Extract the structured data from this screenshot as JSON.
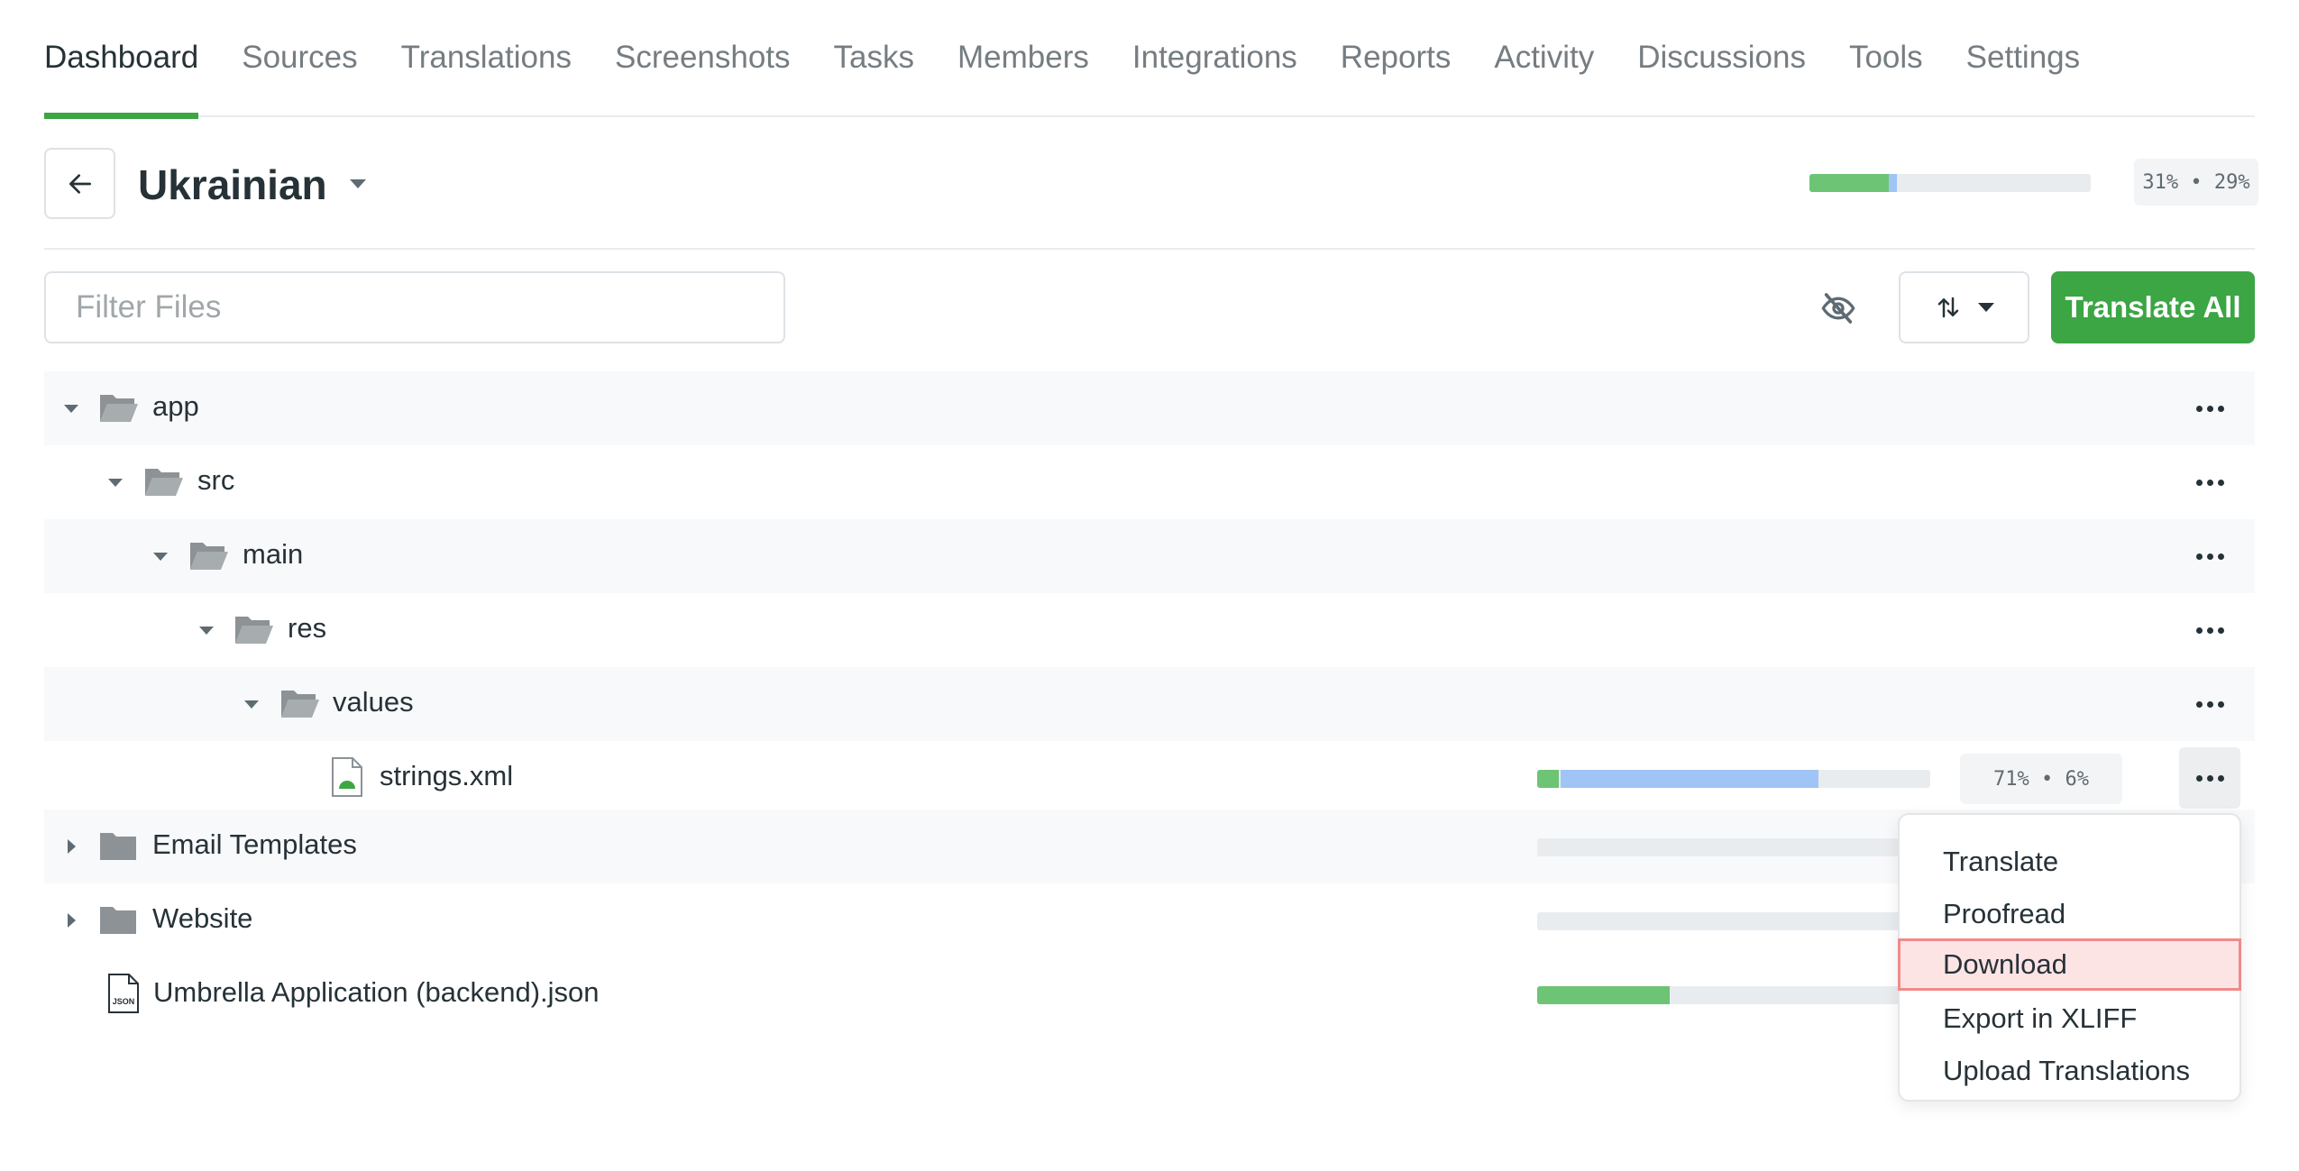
{
  "nav": {
    "tabs": [
      {
        "label": "Dashboard",
        "active": true
      },
      {
        "label": "Sources"
      },
      {
        "label": "Translations"
      },
      {
        "label": "Screenshots"
      },
      {
        "label": "Tasks"
      },
      {
        "label": "Members"
      },
      {
        "label": "Integrations"
      },
      {
        "label": "Reports"
      },
      {
        "label": "Activity"
      },
      {
        "label": "Discussions"
      },
      {
        "label": "Tools"
      },
      {
        "label": "Settings"
      }
    ]
  },
  "header": {
    "language": "Ukrainian",
    "progress": {
      "translated_pct": 31,
      "approved_pct": 29,
      "label": "31% • 29%"
    }
  },
  "toolbar": {
    "filter_placeholder": "Filter Files",
    "filter_value": "",
    "translate_all_label": "Translate All"
  },
  "tree": {
    "rows": [
      {
        "name": "app",
        "type": "folder-open",
        "expanded": true
      },
      {
        "name": "src",
        "type": "folder-open",
        "expanded": true
      },
      {
        "name": "main",
        "type": "folder-open",
        "expanded": true
      },
      {
        "name": "res",
        "type": "folder-open",
        "expanded": true
      },
      {
        "name": "values",
        "type": "folder-open",
        "expanded": true
      },
      {
        "name": "strings.xml",
        "type": "android-file",
        "progress": {
          "approved_pct": 6,
          "translated_pct": 71,
          "label": "71% • 6%"
        }
      },
      {
        "name": "Email Templates",
        "type": "folder-closed",
        "expanded": false,
        "progress": {
          "approved_pct": 0,
          "translated_pct": 0
        }
      },
      {
        "name": "Website",
        "type": "folder-closed",
        "expanded": false,
        "progress": {
          "approved_pct": 0,
          "translated_pct": 0
        }
      },
      {
        "name": "Umbrella Application (backend).json",
        "type": "json-file",
        "icon_text": "JSON",
        "progress": {
          "approved_pct": 20,
          "translated_pct": 20
        }
      }
    ]
  },
  "context_menu": {
    "items": [
      {
        "label": "Translate"
      },
      {
        "label": "Proofread"
      },
      {
        "label": "Download",
        "highlighted": true
      },
      {
        "label": "Export in XLIFF"
      },
      {
        "label": "Upload Translations"
      }
    ]
  },
  "colors": {
    "accent_green": "#3ca544",
    "progress_green": "#6cc474",
    "progress_blue": "#a0c4f5",
    "highlight_border": "#f08a8a",
    "highlight_fill": "#fde4e4"
  }
}
